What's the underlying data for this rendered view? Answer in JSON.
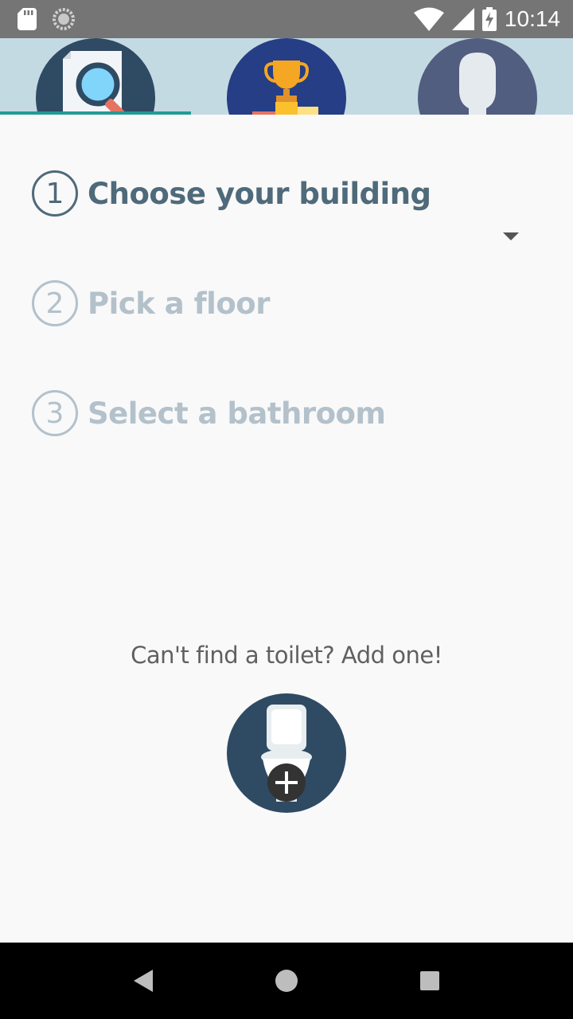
{
  "status_bar": {
    "time": "10:14",
    "icons": [
      "sd-card-icon",
      "sync-icon",
      "wifi-icon",
      "signal-icon",
      "battery-charging-icon"
    ]
  },
  "tabs": [
    {
      "icon": "search-document-icon",
      "selected": true
    },
    {
      "icon": "trophy-podium-icon",
      "selected": false
    },
    {
      "icon": "user-avatar-icon",
      "selected": false
    }
  ],
  "steps": [
    {
      "number": "1",
      "label": "Choose your building",
      "active": true
    },
    {
      "number": "2",
      "label": "Pick a floor",
      "active": false
    },
    {
      "number": "3",
      "label": "Select a bathroom",
      "active": false
    }
  ],
  "building_select": {
    "selected": ""
  },
  "add_toilet": {
    "prompt": "Can't find a toilet? Add one!",
    "icon": "toilet-add-icon"
  },
  "colors": {
    "accent": "#229b94",
    "step_active": "#4f6a7a",
    "step_inactive": "#b3c1cb",
    "tab_background": "#c4dae3",
    "button_background": "#2f4a63"
  },
  "nav_bar": {
    "icons": [
      "back-icon",
      "home-icon",
      "recents-icon"
    ]
  }
}
